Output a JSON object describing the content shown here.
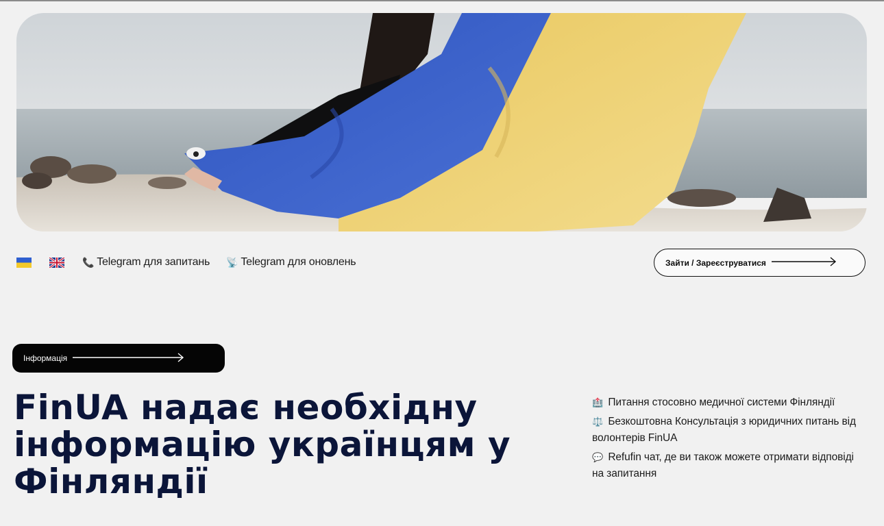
{
  "hero": {
    "image_alt": "Person on a beach holding a blue and yellow Ukrainian flag",
    "colors": {
      "flag_blue": "#3f63c8",
      "flag_yellow": "#efd27a",
      "sky": "#d9dde0",
      "sea": "#a9b2b6"
    }
  },
  "nav": {
    "lang_ua": "uk-flag-icon",
    "lang_en": "gb-flag-icon",
    "telegram_questions": {
      "emoji": "📞",
      "label": "Telegram для запитань"
    },
    "telegram_updates": {
      "emoji": "📡",
      "label": "Telegram для оновлень"
    },
    "login": "Зайти / Зареєструватися"
  },
  "main": {
    "info_button": "Інформація",
    "headline": "FinUA надає необхідну інформацію українцям у Фінляндії",
    "features": [
      {
        "emoji": "🏥",
        "text": "Питання стосовно медичної системи Фінляндії"
      },
      {
        "emoji": "⚖️",
        "text": "Безкоштовна Консультація з юридичних питань від волонтерів FinUA"
      },
      {
        "emoji": "💬",
        "text": "Refufin чат, де ви також можете отримати відповіді на запитання"
      }
    ]
  },
  "colors": {
    "accent": "#0b1539",
    "background": "#f1f1f1",
    "button_dark": "#050505"
  }
}
